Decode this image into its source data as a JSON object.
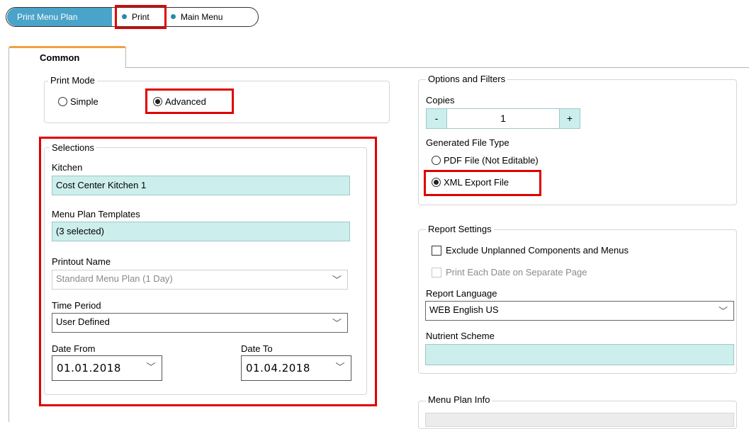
{
  "breadcrumb": {
    "first": "Print Menu Plan",
    "second": "Print",
    "third": "Main Menu"
  },
  "tab": {
    "label": "Common"
  },
  "print_mode": {
    "legend": "Print Mode",
    "simple_label": "Simple",
    "advanced_label": "Advanced",
    "selected": "Advanced"
  },
  "selections": {
    "legend": "Selections",
    "kitchen_label": "Kitchen",
    "kitchen_value": "Cost Center Kitchen 1",
    "templates_label": "Menu Plan Templates",
    "templates_value": "(3 selected)",
    "printout_label": "Printout Name",
    "printout_value": "Standard Menu Plan (1 Day)",
    "time_period_label": "Time Period",
    "time_period_value": "User Defined",
    "date_from_label": "Date From",
    "date_from_value": "01.01.2018",
    "date_to_label": "Date To",
    "date_to_value": "01.04.2018"
  },
  "options": {
    "legend": "Options and Filters",
    "copies_label": "Copies",
    "copies_minus": "-",
    "copies_value": "1",
    "copies_plus": "+",
    "file_type_label": "Generated File Type",
    "pdf_label": "PDF File (Not Editable)",
    "xml_label": "XML Export File",
    "selected": "XML Export File"
  },
  "report_settings": {
    "legend": "Report Settings",
    "exclude_label": "Exclude Unplanned Components and Menus",
    "separate_page_label": "Print Each Date on Separate Page",
    "language_label": "Report Language",
    "language_value": "WEB English US",
    "nutrient_label": "Nutrient Scheme",
    "nutrient_value": ""
  },
  "menu_plan_info": {
    "legend": "Menu Plan Info"
  },
  "colors": {
    "accent": "#4aa3c8",
    "field_teal": "#cceeed",
    "highlight_red": "#e00000",
    "tab_orange": "#f0a040"
  }
}
